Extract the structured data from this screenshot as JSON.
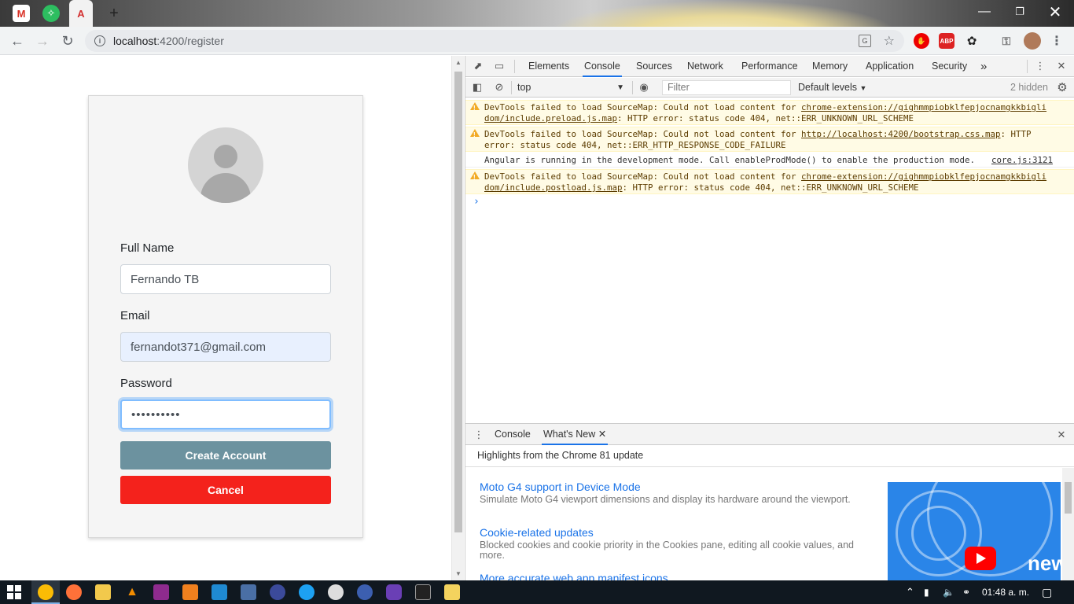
{
  "browser": {
    "tabs": [
      {
        "icon": "gmail-icon",
        "glyph": "M"
      },
      {
        "icon": "evernote-icon",
        "glyph": "✧"
      },
      {
        "icon": "angular-icon",
        "glyph": "A"
      }
    ],
    "new_tab_glyph": "+",
    "url_host": "localhost",
    "url_rest": ":4200/register",
    "extensions": {
      "abp_label": "ABP"
    }
  },
  "form": {
    "full_name_label": "Full Name",
    "full_name_value": "Fernando TB",
    "email_label": "Email",
    "email_value": "fernandot371@gmail.com",
    "password_label": "Password",
    "password_value": "••••••••••",
    "create_button": "Create Account",
    "cancel_button": "Cancel"
  },
  "devtools": {
    "tabs": [
      "Elements",
      "Console",
      "Sources",
      "Network",
      "Performance",
      "Memory",
      "Application",
      "Security"
    ],
    "active_tab": "Console",
    "more_tabs": "»",
    "context": "top",
    "filter_placeholder": "Filter",
    "levels": "Default levels",
    "hidden": "2 hidden",
    "messages": [
      {
        "type": "warning",
        "text": "DevTools failed to load SourceMap: Could not load content for ",
        "link": "chrome-extension://gighmmpiobklfepjocnamgkkbigli dom/include.preload.js.map",
        "rest": ": HTTP error: status code 404, net::ERR_UNKNOWN_URL_SCHEME"
      },
      {
        "type": "warning",
        "text": "DevTools failed to load SourceMap: Could not load content for ",
        "link": "http://localhost:4200/bootstrap.css.map",
        "rest": ": HTTP error: status code 404, net::ERR_HTTP_RESPONSE_CODE_FAILURE"
      },
      {
        "type": "info",
        "text": "Angular is running in the development mode. Call enableProdMode() to enable the production mode.",
        "source": "core.js:3121"
      },
      {
        "type": "warning",
        "text": "DevTools failed to load SourceMap: Could not load content for ",
        "link": "chrome-extension://gighmmpiobklfepjocnamgkkbigli dom/include.postload.js.map",
        "rest": ": HTTP error: status code 404, net::ERR_UNKNOWN_URL_SCHEME"
      }
    ],
    "prompt": "›",
    "drawer": {
      "tabs": [
        "Console",
        "What's New"
      ],
      "active": "What's New",
      "header": "Highlights from the Chrome 81 update",
      "features": [
        {
          "title": "Moto G4 support in Device Mode",
          "desc": "Simulate Moto G4 viewport dimensions and display its hardware around the viewport."
        },
        {
          "title": "Cookie-related updates",
          "desc": "Blocked cookies and cookie priority in the Cookies pane, editing all cookie values, and more."
        },
        {
          "title": "More accurate web app manifest icons",
          "desc": ""
        }
      ],
      "promo_word": "new"
    }
  },
  "taskbar": {
    "time": "01:48 a. m."
  },
  "colors": {
    "create_button": "#6c929f",
    "cancel_button": "#f4221c",
    "devtools_accent": "#1a73e8",
    "warning_bg": "#fffbe5"
  }
}
